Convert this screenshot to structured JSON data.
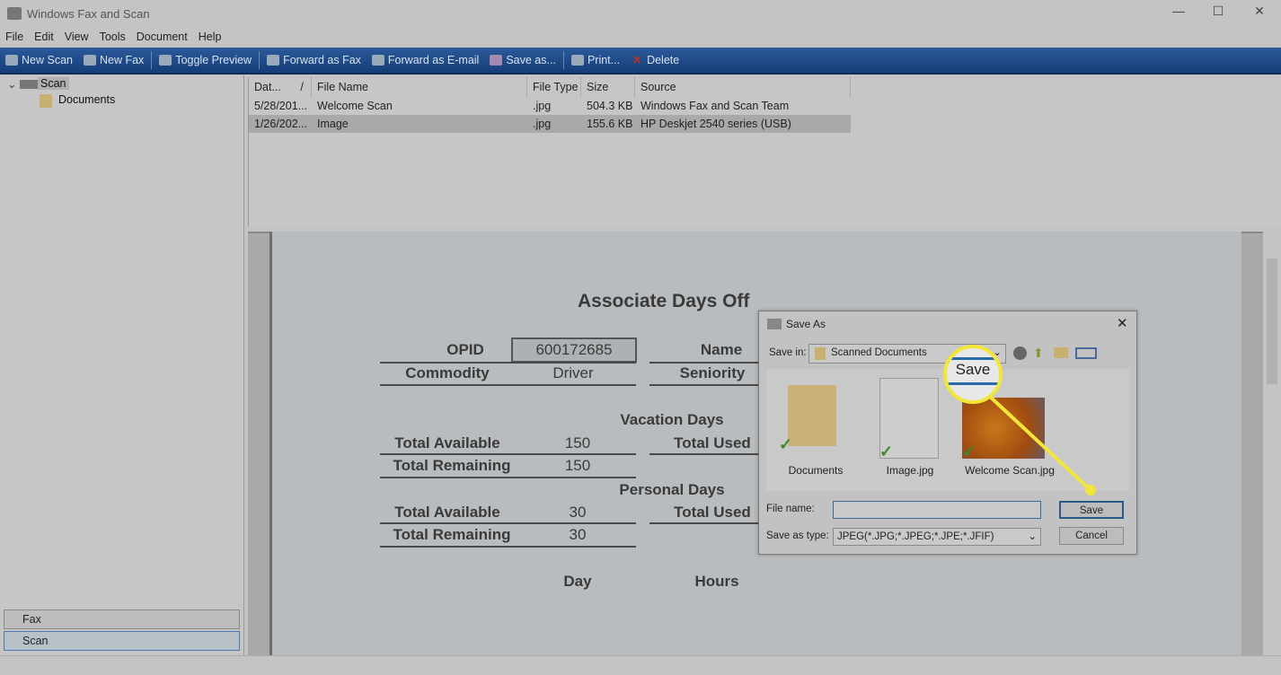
{
  "window": {
    "title": "Windows Fax and Scan",
    "minimize": "—",
    "maximize": "☐",
    "close": "✕"
  },
  "menu": [
    "File",
    "Edit",
    "View",
    "Tools",
    "Document",
    "Help"
  ],
  "toolbar": [
    {
      "label": "New Scan",
      "icon": "scanner-icon"
    },
    {
      "label": "New Fax",
      "icon": "new-fax-icon"
    },
    {
      "label": "Toggle Preview",
      "icon": "preview-icon"
    },
    {
      "label": "Forward as Fax",
      "icon": "fax-icon"
    },
    {
      "label": "Forward as E-mail",
      "icon": "email-icon"
    },
    {
      "label": "Save as...",
      "icon": "save-icon"
    },
    {
      "label": "Print...",
      "icon": "print-icon"
    },
    {
      "label": "Delete",
      "icon": "delete-icon"
    }
  ],
  "tree": {
    "root": "Scan",
    "child": "Documents"
  },
  "nav": {
    "fax": "Fax",
    "scan": "Scan"
  },
  "list": {
    "columns": [
      "Dat...",
      "File Name",
      "File Type",
      "Size",
      "Source"
    ],
    "sort_indicator": "/",
    "rows": [
      {
        "date": "5/28/201...",
        "name": "Welcome Scan",
        "type": ".jpg",
        "size": "504.3 KB",
        "source": "Windows Fax and Scan Team"
      },
      {
        "date": "1/26/202...",
        "name": "Image",
        "type": ".jpg",
        "size": "155.6 KB",
        "source": "HP Deskjet 2540 series (USB)",
        "selected": true
      }
    ]
  },
  "document": {
    "title": "Associate Days Off",
    "opid_label": "OPID",
    "opid": "600172685",
    "name_label": "Name",
    "commodity_label": "Commodity",
    "commodity": "Driver",
    "seniority_label": "Seniority",
    "vacation": "Vacation Days",
    "personal": "Personal Days",
    "total_available": "Total Available",
    "total_remaining": "Total Remaining",
    "total_used": "Total Used",
    "vac_available": "150",
    "vac_remaining": "150",
    "per_available": "30",
    "per_remaining": "30",
    "day": "Day",
    "hours": "Hours"
  },
  "dialog": {
    "title": "Save As",
    "close": "✕",
    "save_in_label": "Save in:",
    "save_in": "Scanned Documents",
    "items": [
      "Documents",
      "Image.jpg",
      "Welcome Scan.jpg"
    ],
    "file_name_label": "File name:",
    "file_name": "",
    "save_type_label": "Save as type:",
    "save_type": "JPEG(*.JPG;*.JPEG;*.JPE;*.JFIF)",
    "save": "Save",
    "cancel": "Cancel"
  },
  "callout": {
    "text": "Save",
    "color": "#f2e63a"
  }
}
